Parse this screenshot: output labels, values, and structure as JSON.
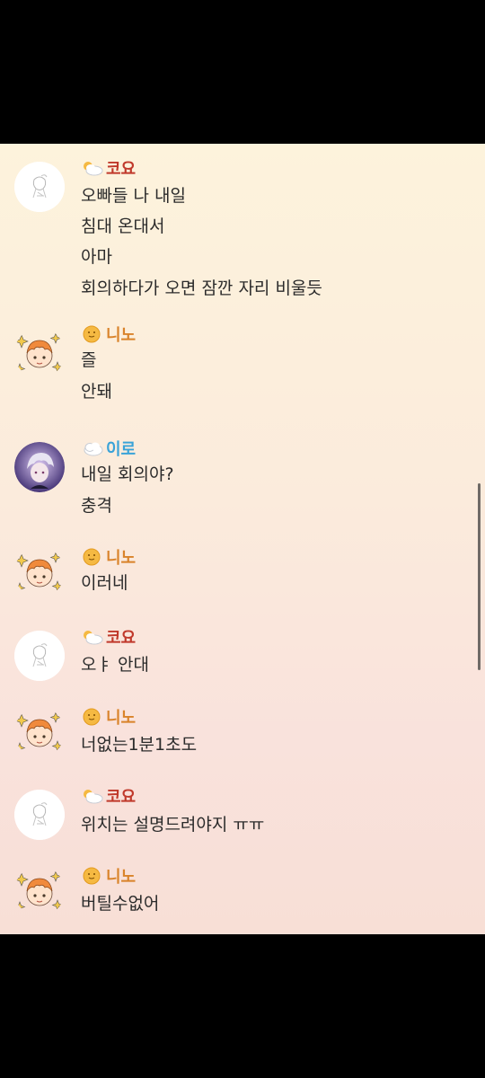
{
  "chat": {
    "messages": [
      {
        "sender": "코요",
        "sender_color": "#c0392b",
        "sender_icon": "cloud-sun-icon",
        "avatar": "sketch-avatar-icon",
        "lines": [
          "오빠들 나 내일",
          "침대 온대서",
          "아마",
          "회의하다가 오면 잠깐 자리 비울듯"
        ]
      },
      {
        "sender": "니노",
        "sender_color": "#d9832a",
        "sender_icon": "sun-face-icon",
        "avatar": "orange-hair-sparkle-avatar-icon",
        "lines": [
          "즐",
          "안돼"
        ]
      },
      {
        "sender": "이로",
        "sender_color": "#3aa3d8",
        "sender_icon": "cloud-icon",
        "avatar": "silver-hair-avatar-icon",
        "lines": [
          "내일 회의야?",
          "충격"
        ]
      },
      {
        "sender": "니노",
        "sender_color": "#d9832a",
        "sender_icon": "sun-face-icon",
        "avatar": "orange-hair-sparkle-avatar-icon",
        "lines": [
          "이러네"
        ]
      },
      {
        "sender": "코요",
        "sender_color": "#c0392b",
        "sender_icon": "cloud-sun-icon",
        "avatar": "sketch-avatar-icon",
        "lines": [
          "오ㅑ 안대"
        ]
      },
      {
        "sender": "니노",
        "sender_color": "#d9832a",
        "sender_icon": "sun-face-icon",
        "avatar": "orange-hair-sparkle-avatar-icon",
        "lines": [
          "너없는1분1초도"
        ]
      },
      {
        "sender": "코요",
        "sender_color": "#c0392b",
        "sender_icon": "cloud-sun-icon",
        "avatar": "sketch-avatar-icon",
        "lines": [
          "위치는 설명드려야지 ㅠㅠ"
        ]
      },
      {
        "sender": "니노",
        "sender_color": "#d9832a",
        "sender_icon": "sun-face-icon",
        "avatar": "orange-hair-sparkle-avatar-icon",
        "lines": [
          "버틸수없어"
        ]
      }
    ]
  }
}
